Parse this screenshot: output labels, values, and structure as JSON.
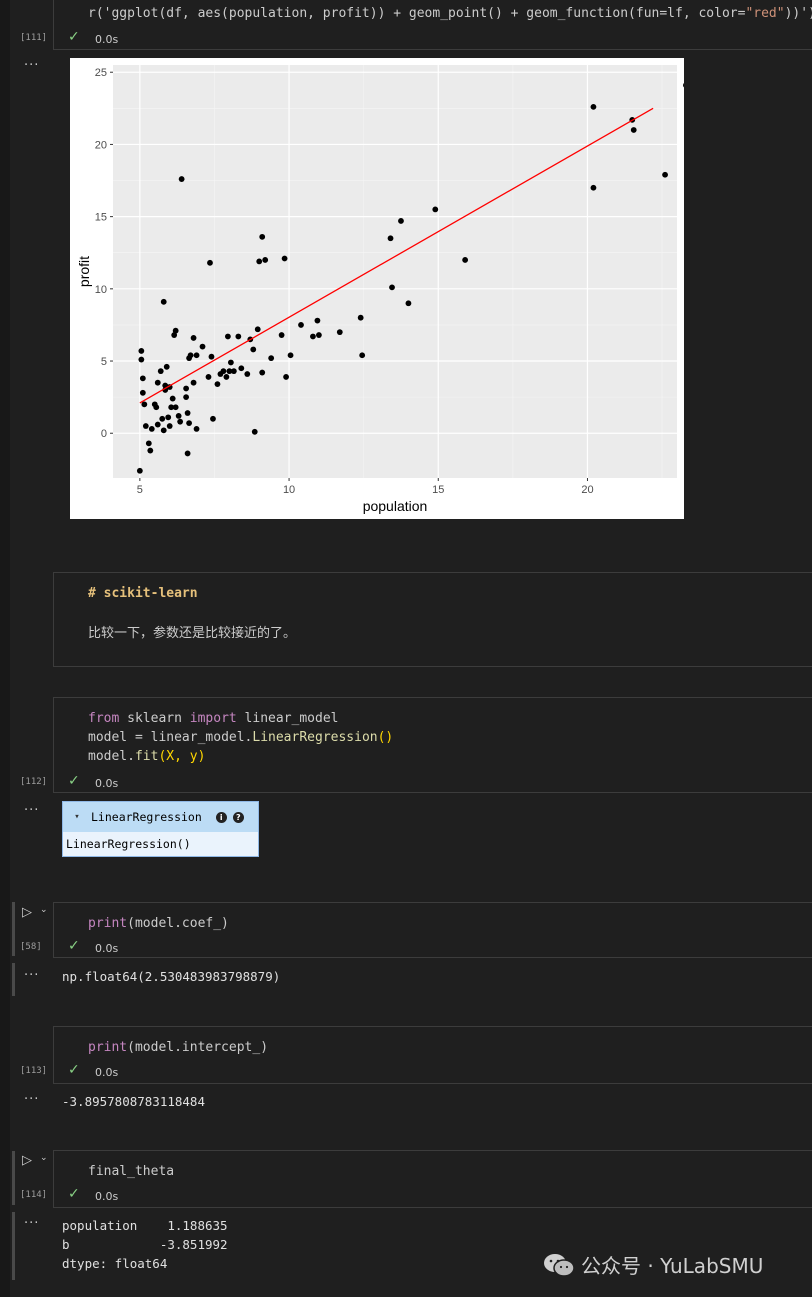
{
  "cell111": {
    "code_prefix": "r('ggplot(df, aes(population, profit)) + geom_point() + geom_function(fun=lf, color=",
    "code_string": "\"red\"",
    "code_suffix": "))')",
    "exec_count": "[111]",
    "time": "0.0s"
  },
  "plot": {
    "xlabel": "population",
    "ylabel": "profit",
    "xticks": [
      "5",
      "10",
      "15",
      "20"
    ],
    "yticks": [
      "0",
      "5",
      "10",
      "15",
      "20",
      "25"
    ]
  },
  "chart_data": {
    "type": "scatter",
    "xlabel": "population",
    "ylabel": "profit",
    "xlim": [
      4.1,
      23.0
    ],
    "ylim": [
      -3.1,
      25.5
    ],
    "points": [
      [
        5.0,
        -2.6
      ],
      [
        5.05,
        5.7
      ],
      [
        5.05,
        5.1
      ],
      [
        5.1,
        3.8
      ],
      [
        5.1,
        2.8
      ],
      [
        5.15,
        2.0
      ],
      [
        5.2,
        0.5
      ],
      [
        5.3,
        -0.7
      ],
      [
        5.35,
        -1.2
      ],
      [
        5.4,
        0.3
      ],
      [
        5.5,
        2.0
      ],
      [
        5.55,
        1.8
      ],
      [
        5.6,
        3.5
      ],
      [
        5.6,
        0.6
      ],
      [
        5.7,
        4.3
      ],
      [
        5.75,
        1.0
      ],
      [
        5.8,
        0.2
      ],
      [
        5.8,
        9.1
      ],
      [
        5.85,
        3.3
      ],
      [
        5.85,
        3.0
      ],
      [
        5.9,
        3.2
      ],
      [
        5.9,
        4.6
      ],
      [
        5.95,
        1.1
      ],
      [
        6.0,
        0.5
      ],
      [
        6.0,
        3.2
      ],
      [
        6.05,
        1.8
      ],
      [
        6.1,
        2.4
      ],
      [
        6.15,
        6.8
      ],
      [
        6.2,
        7.1
      ],
      [
        6.2,
        1.8
      ],
      [
        6.3,
        1.2
      ],
      [
        6.35,
        0.8
      ],
      [
        6.4,
        17.6
      ],
      [
        6.55,
        3.1
      ],
      [
        6.55,
        2.5
      ],
      [
        6.6,
        1.4
      ],
      [
        6.65,
        5.2
      ],
      [
        6.7,
        5.4
      ],
      [
        6.8,
        6.6
      ],
      [
        6.8,
        3.5
      ],
      [
        6.9,
        5.4
      ],
      [
        6.9,
        0.3
      ],
      [
        6.65,
        0.7
      ],
      [
        6.6,
        -1.4
      ],
      [
        7.1,
        6.0
      ],
      [
        7.3,
        3.9
      ],
      [
        7.35,
        11.8
      ],
      [
        7.4,
        5.3
      ],
      [
        7.45,
        1.0
      ],
      [
        7.6,
        3.4
      ],
      [
        7.7,
        4.1
      ],
      [
        7.8,
        4.3
      ],
      [
        7.9,
        3.9
      ],
      [
        7.95,
        6.7
      ],
      [
        8.0,
        4.3
      ],
      [
        8.05,
        4.9
      ],
      [
        8.15,
        4.3
      ],
      [
        8.3,
        6.7
      ],
      [
        8.4,
        4.5
      ],
      [
        8.6,
        4.1
      ],
      [
        8.7,
        6.5
      ],
      [
        8.8,
        5.8
      ],
      [
        8.85,
        0.1
      ],
      [
        8.95,
        7.2
      ],
      [
        9.0,
        11.9
      ],
      [
        9.1,
        4.2
      ],
      [
        9.1,
        13.6
      ],
      [
        9.2,
        12.0
      ],
      [
        9.4,
        5.2
      ],
      [
        9.75,
        6.8
      ],
      [
        9.85,
        12.1
      ],
      [
        9.9,
        3.9
      ],
      [
        10.05,
        5.4
      ],
      [
        10.4,
        7.5
      ],
      [
        10.8,
        6.7
      ],
      [
        10.95,
        7.8
      ],
      [
        11.0,
        6.8
      ],
      [
        11.7,
        7.0
      ],
      [
        12.4,
        8.0
      ],
      [
        12.45,
        5.4
      ],
      [
        13.4,
        13.5
      ],
      [
        13.45,
        10.1
      ],
      [
        13.75,
        14.7
      ],
      [
        14.0,
        9.0
      ],
      [
        14.9,
        15.5
      ],
      [
        15.9,
        12.0
      ],
      [
        20.2,
        17.0
      ],
      [
        20.2,
        22.6
      ],
      [
        21.5,
        21.7
      ],
      [
        21.55,
        21.0
      ],
      [
        22.6,
        17.9
      ],
      [
        23.3,
        24.1
      ]
    ],
    "line": {
      "color": "#ff0000",
      "x": [
        5.0,
        22.2
      ],
      "y": [
        2.1,
        22.5
      ]
    },
    "grid": true,
    "background": "#ebebeb"
  },
  "markdown": {
    "heading": "# scikit-learn",
    "text": "比较一下，参数还是比较接近的了。"
  },
  "cell112": {
    "line1_kw1": "from",
    "line1_mid": " sklearn ",
    "line1_kw2": "import",
    "line1_end": " linear_model",
    "line2_a": "model ",
    "line2_b": "= ",
    "line2_c": "linear_model.",
    "line2_fn": "LinearRegression",
    "line2_paren": "()",
    "line3_a": "model.",
    "line3_fn": "fit",
    "line3_args": "(X, y)",
    "exec_count": "[112]",
    "time": "0.0s"
  },
  "widget": {
    "title": "LinearRegression",
    "body": "LinearRegression()",
    "arrow": "▾",
    "info": "i",
    "help": "?"
  },
  "cell58": {
    "fn": "print",
    "args": "(model.coef_)",
    "exec_count": "[58]",
    "time": "0.0s",
    "output": "np.float64(2.530483983798879)"
  },
  "cell113": {
    "fn": "print",
    "args": "(model.intercept_)",
    "exec_count": "[113]",
    "time": "0.0s",
    "output": "-3.8957808783118484"
  },
  "cell114": {
    "code": "final_theta",
    "exec_count": "[114]",
    "time": "0.0s",
    "output_line1": "population    1.188635",
    "output_line2": "b            -3.851992",
    "output_line3": "dtype: float64"
  },
  "ui": {
    "dots": "···",
    "check": "✓",
    "run": "▷",
    "chevron": "⌄"
  },
  "watermark": {
    "text": "公众号 · YuLabSMU"
  }
}
